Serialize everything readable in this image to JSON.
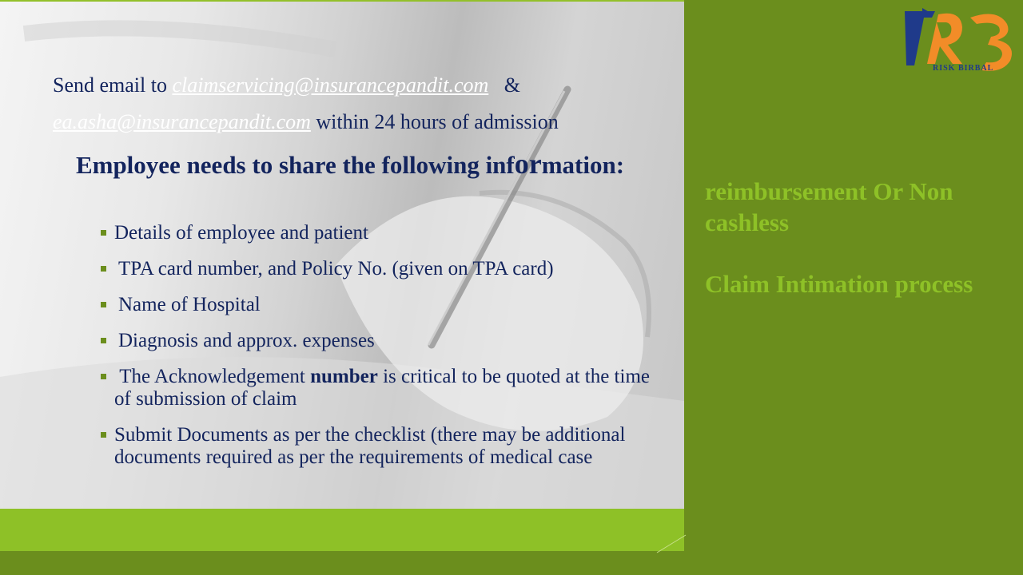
{
  "slide": {
    "line1_prefix": "Send email to",
    "email1": "claimservicing@insurancepandit.com",
    "line1_suffix": "&",
    "email2": "ea.asha@insurancepandit.com",
    "line2_suffix": "within 24 hours of admission",
    "heading_part1": "Employee needs to share the following inf",
    "heading_or": "or",
    "heading_part2": "mation:",
    "bullets": [
      "Details of employee and patient",
      "TPA card number, and Policy No. (given on TPA card)",
      "Name of Hospital",
      "Diagnosis and approx. expenses",
      "Submit Documents as per the checklist (there may be additional documents required as per the requirements of medical case"
    ],
    "ack_prefix": "The Acknowledgement",
    "ack_bold": "number",
    "ack_suffix": "is critical to be quoted at the time of   submission of claim"
  },
  "side": {
    "title1": "reimbursement Or Non cashless",
    "title2": "Claim Intimation process"
  },
  "logo": {
    "text": "RISK BIRBAL",
    "icon": "rb-logo-icon"
  },
  "colors": {
    "navy": "#13245d",
    "green_dark": "#6b8e1d",
    "green_light": "#8ec127"
  }
}
